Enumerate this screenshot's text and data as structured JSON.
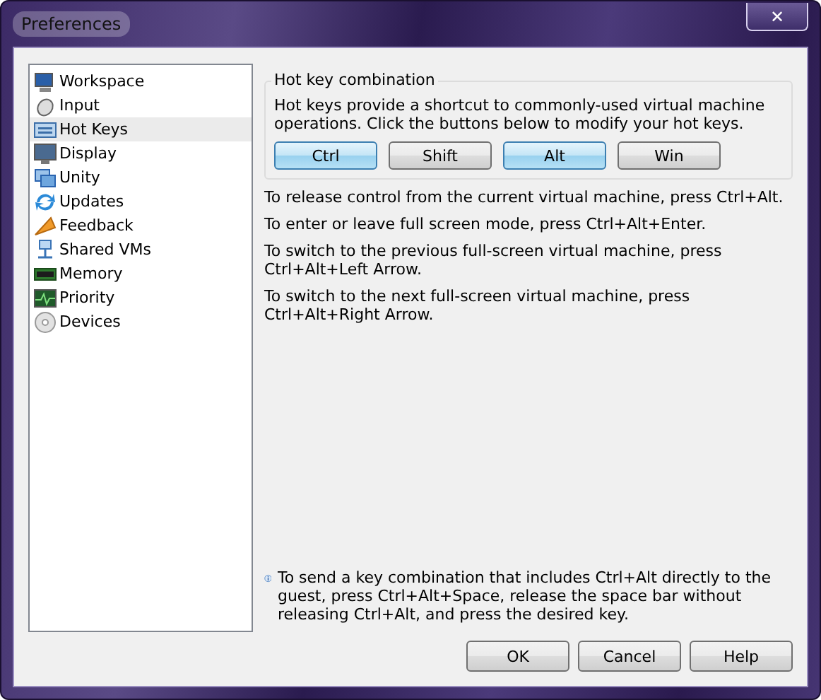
{
  "window": {
    "title": "Preferences",
    "close": "✕"
  },
  "sidebar": {
    "items": [
      {
        "label": "Workspace",
        "selected": false
      },
      {
        "label": "Input",
        "selected": false
      },
      {
        "label": "Hot Keys",
        "selected": true
      },
      {
        "label": "Display",
        "selected": false
      },
      {
        "label": "Unity",
        "selected": false
      },
      {
        "label": "Updates",
        "selected": false
      },
      {
        "label": "Feedback",
        "selected": false
      },
      {
        "label": "Shared VMs",
        "selected": false
      },
      {
        "label": "Memory",
        "selected": false
      },
      {
        "label": "Priority",
        "selected": false
      },
      {
        "label": "Devices",
        "selected": false
      }
    ]
  },
  "hotkeys": {
    "title": "Hot key combination",
    "description": "Hot keys provide a shortcut to commonly-used virtual machine operations. Click the buttons below to modify your hot keys.",
    "keys": [
      {
        "label": "Ctrl",
        "selected": true
      },
      {
        "label": "Shift",
        "selected": false
      },
      {
        "label": "Alt",
        "selected": true
      },
      {
        "label": "Win",
        "selected": false
      }
    ]
  },
  "instructions": [
    "To release control from the current virtual machine, press Ctrl+Alt.",
    "To enter or leave full screen mode, press Ctrl+Alt+Enter.",
    "To switch to the previous full-screen virtual machine, press Ctrl+Alt+Left Arrow.",
    "To switch to the next full-screen virtual machine, press Ctrl+Alt+Right Arrow."
  ],
  "note": "To send a key combination that includes Ctrl+Alt directly to the guest, press Ctrl+Alt+Space, release the space bar without releasing Ctrl+Alt, and press the desired key.",
  "buttons": [
    "OK",
    "Cancel",
    "Help"
  ]
}
